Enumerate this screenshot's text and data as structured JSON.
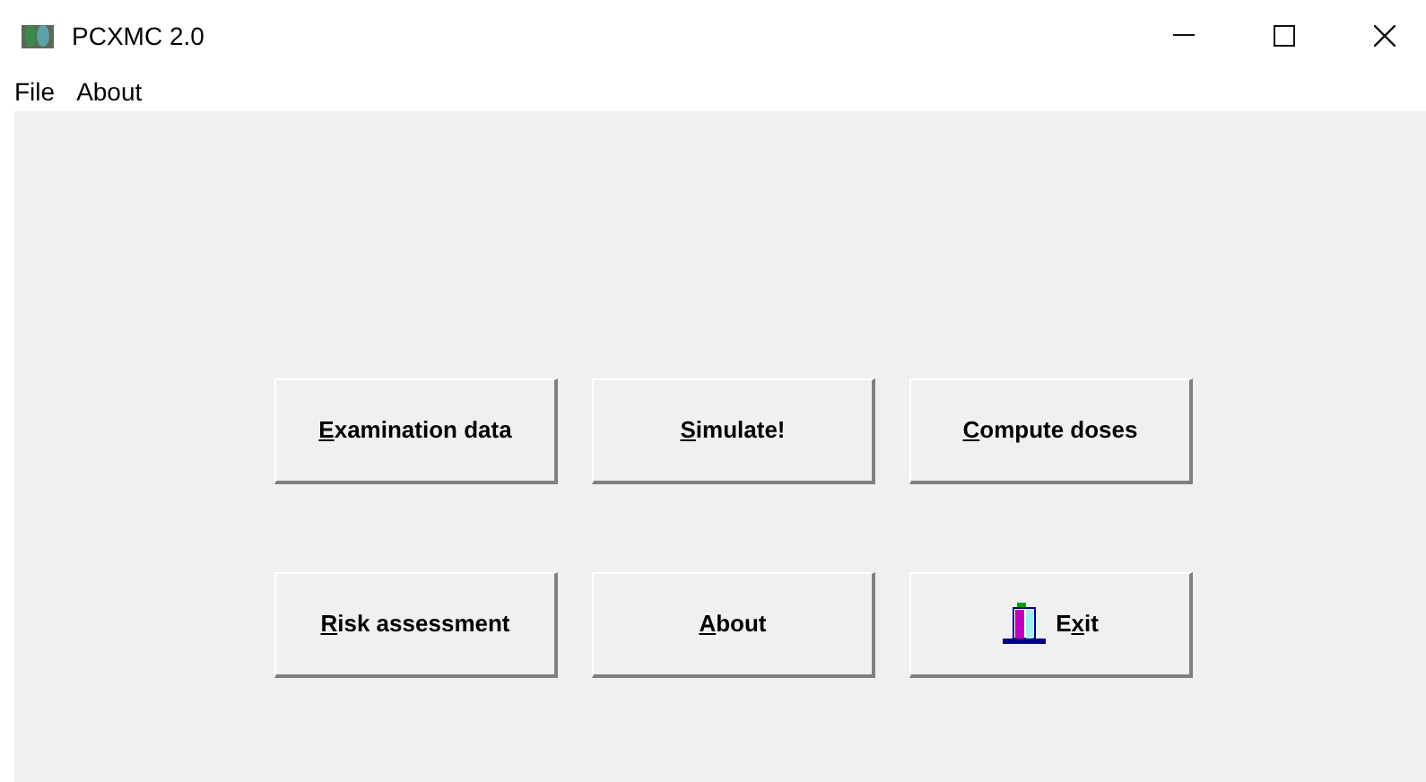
{
  "window": {
    "title": "PCXMC 2.0"
  },
  "menu": [
    "File",
    "About"
  ],
  "buttons": [
    {
      "kind": "text",
      "key": "E",
      "rest": "xamination data"
    },
    {
      "kind": "text",
      "key": "S",
      "rest": "imulate!"
    },
    {
      "kind": "text",
      "key": "C",
      "rest": "ompute doses"
    },
    {
      "kind": "text",
      "key": "R",
      "rest": "isk assessment"
    },
    {
      "kind": "text",
      "key": "A",
      "rest": "bout"
    },
    {
      "kind": "exit",
      "pre": "E",
      "key": "x",
      "rest": "it"
    }
  ]
}
